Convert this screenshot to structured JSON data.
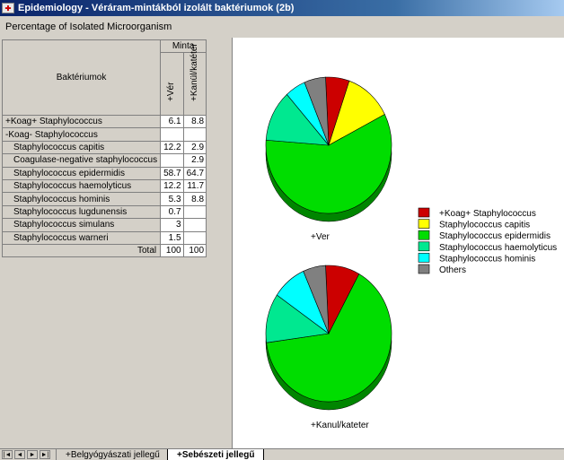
{
  "window": {
    "title": "Epidemiology - Véráram-mintákból izolált baktériumok (2b)"
  },
  "report": {
    "subtitle": "Percentage of Isolated Microorganism"
  },
  "table": {
    "group_header": "Minta",
    "row_header": "Baktériumok",
    "columns": [
      "+Vér",
      "+Kanül/katéter"
    ],
    "rows": [
      {
        "label": "+Koag+ Staphylococcus",
        "indent": false,
        "values": [
          "6.1",
          "8.8"
        ]
      },
      {
        "label": "-Koag- Staphylococcus",
        "indent": false,
        "values": [
          "",
          ""
        ]
      },
      {
        "label": "Staphylococcus capitis",
        "indent": true,
        "values": [
          "12.2",
          "2.9"
        ]
      },
      {
        "label": "Coagulase-negative staphylococcus",
        "indent": true,
        "values": [
          "",
          "2.9"
        ]
      },
      {
        "label": "Staphylococcus epidermidis",
        "indent": true,
        "values": [
          "58.7",
          "64.7"
        ]
      },
      {
        "label": "Staphylococcus haemolyticus",
        "indent": true,
        "values": [
          "12.2",
          "11.7"
        ]
      },
      {
        "label": "Staphylococcus hominis",
        "indent": true,
        "values": [
          "5.3",
          "8.8"
        ]
      },
      {
        "label": "Staphylococcus lugdunensis",
        "indent": true,
        "values": [
          "0.7",
          ""
        ]
      },
      {
        "label": "Staphylococcus simulans",
        "indent": true,
        "values": [
          "3",
          ""
        ]
      },
      {
        "label": "Staphylococcus warneri",
        "indent": true,
        "values": [
          "1.5",
          ""
        ]
      }
    ],
    "total": {
      "label": "Total",
      "values": [
        "100",
        "100"
      ]
    }
  },
  "legend": [
    {
      "label": "+Koag+ Staphylococcus",
      "color": "#cc0000"
    },
    {
      "label": "Staphylococcus capitis",
      "color": "#ffff00"
    },
    {
      "label": "Staphylococcus epidermidis",
      "color": "#00dd00"
    },
    {
      "label": "Staphylococcus haemolyticus",
      "color": "#00e890"
    },
    {
      "label": "Staphylococcus hominis",
      "color": "#00ffff"
    },
    {
      "label": "Others",
      "color": "#808080"
    }
  ],
  "chart_data": [
    {
      "type": "pie",
      "title": "+Ver",
      "categories": [
        "+Koag+ Staphylococcus",
        "Staphylococcus capitis",
        "Staphylococcus epidermidis",
        "Staphylococcus haemolyticus",
        "Staphylococcus hominis",
        "Others"
      ],
      "values": [
        6.1,
        12.2,
        58.7,
        12.2,
        5.3,
        5.5
      ]
    },
    {
      "type": "pie",
      "title": "+Kanul/kateter",
      "categories": [
        "+Koag+ Staphylococcus",
        "Staphylococcus capitis",
        "Staphylococcus epidermidis",
        "Staphylococcus haemolyticus",
        "Staphylococcus hominis",
        "Others"
      ],
      "values": [
        8.8,
        0,
        64.7,
        11.7,
        8.8,
        5.8
      ]
    }
  ],
  "tabs": [
    {
      "label": "+Belgyógyászati jellegű",
      "active": false
    },
    {
      "label": "+Sebészeti jellegű",
      "active": true
    }
  ]
}
